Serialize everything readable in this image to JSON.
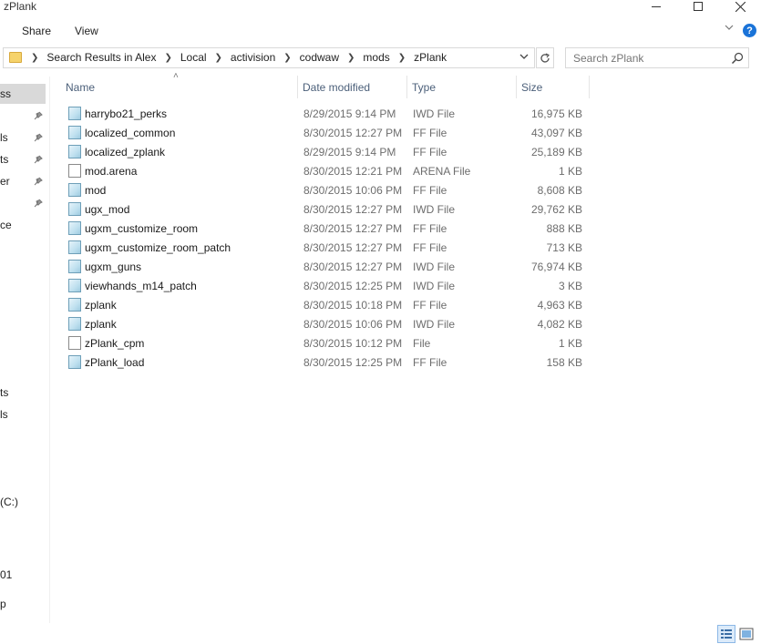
{
  "window": {
    "title": "zPlank"
  },
  "ribbon": {
    "tabs": [
      "Share",
      "View"
    ],
    "expand_icon": "chevron-down-icon",
    "help_icon": "help-icon"
  },
  "address": {
    "crumbs": [
      "Search Results in Alex",
      "Local",
      "activision",
      "codwaw",
      "mods",
      "zPlank"
    ]
  },
  "search": {
    "placeholder": "Search zPlank"
  },
  "nav": {
    "items": [
      "ss",
      "ls",
      "ts",
      "er",
      "ce",
      "ts",
      "ls",
      "(C:)",
      "01",
      "p"
    ]
  },
  "columns": {
    "name": "Name",
    "date": "Date modified",
    "type": "Type",
    "size": "Size"
  },
  "files": [
    {
      "name": "harrybo21_perks",
      "date": "8/29/2015 9:14 PM",
      "type": "IWD File",
      "size": "16,975 KB",
      "icon": "ff"
    },
    {
      "name": "localized_common",
      "date": "8/30/2015 12:27 PM",
      "type": "FF File",
      "size": "43,097 KB",
      "icon": "ff"
    },
    {
      "name": "localized_zplank",
      "date": "8/29/2015 9:14 PM",
      "type": "FF File",
      "size": "25,189 KB",
      "icon": "ff"
    },
    {
      "name": "mod.arena",
      "date": "8/30/2015 12:21 PM",
      "type": "ARENA File",
      "size": "1 KB",
      "icon": "plain"
    },
    {
      "name": "mod",
      "date": "8/30/2015 10:06 PM",
      "type": "FF File",
      "size": "8,608 KB",
      "icon": "ff"
    },
    {
      "name": "ugx_mod",
      "date": "8/30/2015 12:27 PM",
      "type": "IWD File",
      "size": "29,762 KB",
      "icon": "ff"
    },
    {
      "name": "ugxm_customize_room",
      "date": "8/30/2015 12:27 PM",
      "type": "FF File",
      "size": "888 KB",
      "icon": "ff"
    },
    {
      "name": "ugxm_customize_room_patch",
      "date": "8/30/2015 12:27 PM",
      "type": "FF File",
      "size": "713 KB",
      "icon": "ff"
    },
    {
      "name": "ugxm_guns",
      "date": "8/30/2015 12:27 PM",
      "type": "IWD File",
      "size": "76,974 KB",
      "icon": "ff"
    },
    {
      "name": "viewhands_m14_patch",
      "date": "8/30/2015 12:25 PM",
      "type": "IWD File",
      "size": "3 KB",
      "icon": "ff"
    },
    {
      "name": "zplank",
      "date": "8/30/2015 10:18 PM",
      "type": "FF File",
      "size": "4,963 KB",
      "icon": "ff"
    },
    {
      "name": "zplank",
      "date": "8/30/2015 10:06 PM",
      "type": "IWD File",
      "size": "4,082 KB",
      "icon": "ff"
    },
    {
      "name": "zPlank_cpm",
      "date": "8/30/2015 10:12 PM",
      "type": "File",
      "size": "1 KB",
      "icon": "plain"
    },
    {
      "name": "zPlank_load",
      "date": "8/30/2015 12:25 PM",
      "type": "FF File",
      "size": "158 KB",
      "icon": "ff"
    }
  ]
}
